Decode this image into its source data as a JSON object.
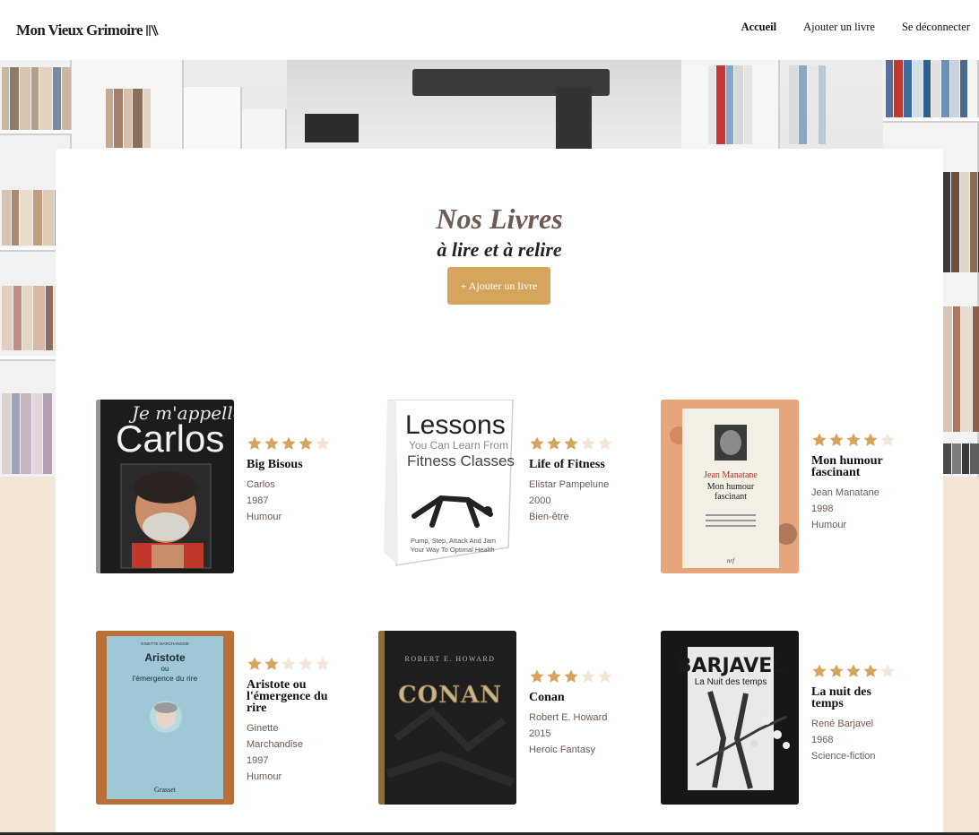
{
  "header": {
    "logo_text": "Mon Vieux Grimoire",
    "nav": [
      {
        "label": "Accueil",
        "active": true
      },
      {
        "label": "Ajouter un livre",
        "active": false
      },
      {
        "label": "Se déconnecter",
        "active": false
      }
    ]
  },
  "main": {
    "title": "Nos Livres",
    "subtitle": "à lire et à relire",
    "add_button": "+ Ajouter un livre"
  },
  "books": [
    {
      "title": "Big Bisous",
      "author": "Carlos",
      "year": "1987",
      "genre": "Humour",
      "rating": 4,
      "cover": {
        "lines": [
          "Je m'appelle",
          "Carlos"
        ]
      }
    },
    {
      "title": "Life of Fitness",
      "author": "Elistar Pampelune",
      "year": "2000",
      "genre": "Bien-être",
      "rating": 3,
      "cover": {
        "lines": [
          "Lessons",
          "You Can Learn From",
          "Fitness Classes",
          "Pump, Step, Attack And Jam",
          "Your Way To Optimal Health"
        ]
      }
    },
    {
      "title": "Mon humour fascinant",
      "author": "Jean Manatane",
      "year": "1998",
      "genre": "Humour",
      "rating": 4,
      "cover": {
        "lines": [
          "Jean Manatane",
          "Mon humour",
          "fascinant",
          "nrf"
        ]
      }
    },
    {
      "title": "Aristote ou l'émergence du rire",
      "author": "Ginette Marchandise",
      "year": "1997",
      "genre": "Humour",
      "rating": 2,
      "cover": {
        "lines": [
          "GINETTE MARCHANDISE",
          "Aristote",
          "ou",
          "l'émergence du rire",
          "Grasset"
        ]
      }
    },
    {
      "title": "Conan",
      "author": "Robert E. Howard",
      "year": "2015",
      "genre": "Heroic Fantasy",
      "rating": 3,
      "cover": {
        "lines": [
          "ROBERT E. HOWARD",
          "CONAN"
        ]
      }
    },
    {
      "title": "La nuit des temps",
      "author": "René Barjavel",
      "year": "1968",
      "genre": "Science-fiction",
      "rating": 4,
      "cover": {
        "lines": [
          "BARJAVEL",
          "La Nuit des temps"
        ]
      }
    }
  ],
  "colors": {
    "accent": "#d6a55d",
    "star_filled": "#d6a55d",
    "star_empty": "#f3e6d6",
    "title_brown": "#6e5a52",
    "page_bg": "#f3e6d6"
  }
}
